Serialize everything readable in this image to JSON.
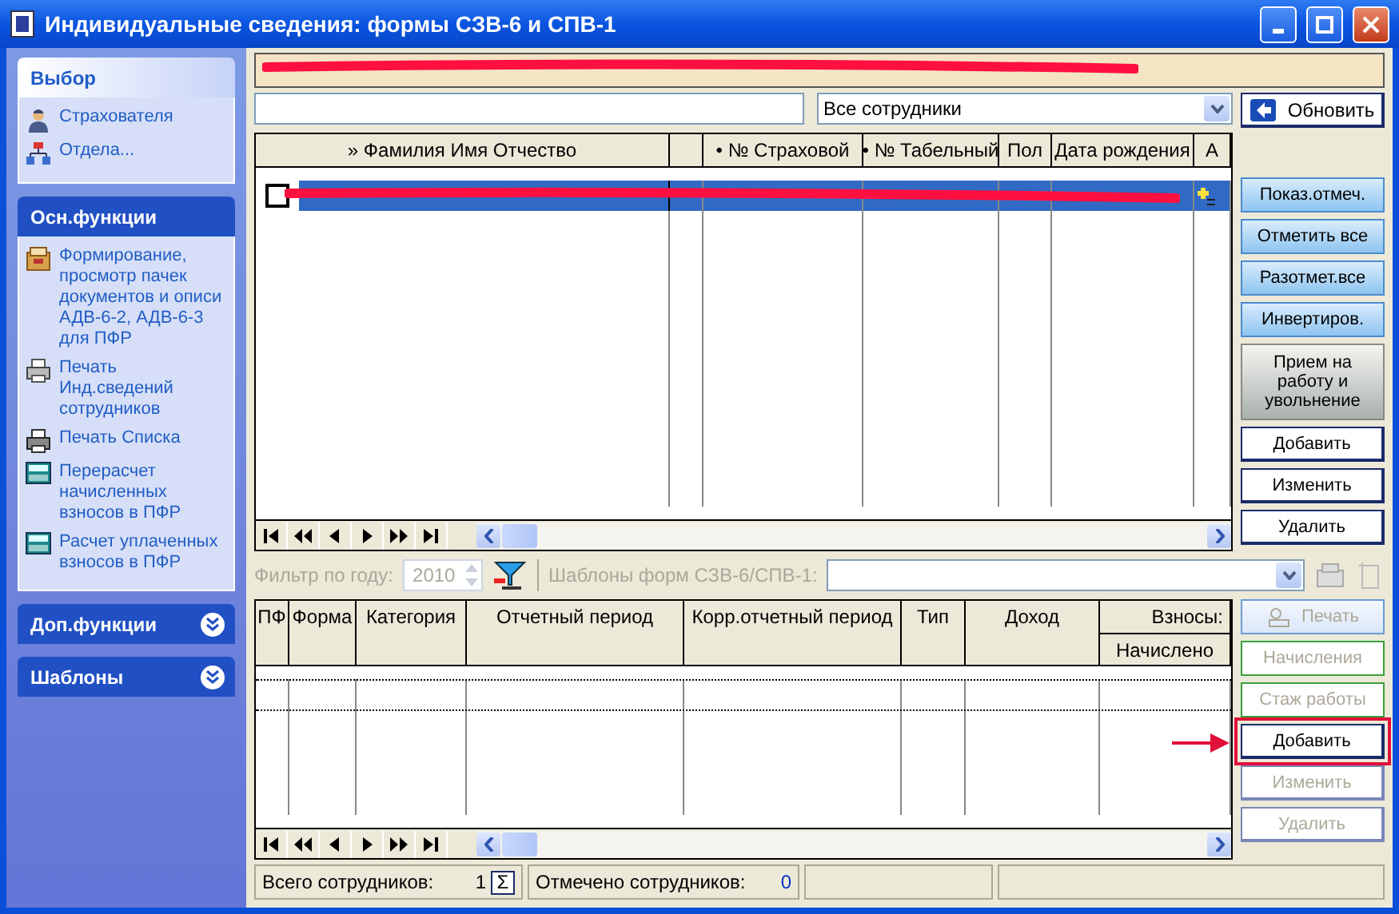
{
  "window": {
    "title": "Индивидуальные сведения: формы СЗВ-6 и СПВ-1"
  },
  "sidebar": {
    "groups": [
      {
        "title": "Выбор",
        "kind": "light",
        "expanded": true,
        "items": [
          {
            "label": "Страхователя"
          },
          {
            "label": "Отдела..."
          }
        ]
      },
      {
        "title": "Осн.функции",
        "kind": "dark",
        "expanded": true,
        "items": [
          {
            "label": "Формирование, просмотр пачек документов и описи АДВ-6-2, АДВ-6-3 для ПФР"
          },
          {
            "label": "Печать Инд.сведений сотрудников"
          },
          {
            "label": "Печать Списка"
          },
          {
            "label": "Перерасчет начисленных взносов в ПФР"
          },
          {
            "label": "Расчет уплаченных взносов в ПФР"
          }
        ]
      },
      {
        "title": "Доп.функции",
        "kind": "dark",
        "expanded": false
      },
      {
        "title": "Шаблоны",
        "kind": "dark",
        "expanded": false
      }
    ]
  },
  "banner": {
    "redacted": true
  },
  "employee_filter": {
    "value": "Все сотрудники"
  },
  "refresh_button": {
    "label": "Обновить"
  },
  "employees_table": {
    "columns": [
      {
        "label": "» Фамилия Имя Отчество"
      },
      {
        "label": "• № Страховой"
      },
      {
        "label": "• № Табельный"
      },
      {
        "label": "Пол"
      },
      {
        "label": "Дата рождения"
      },
      {
        "label": "А"
      }
    ],
    "rows": [
      {
        "selected": true,
        "checked": false,
        "redacted": true
      }
    ]
  },
  "employee_buttons": [
    {
      "label": "Показ.отмеч.",
      "kind": "toggle",
      "disabled": false,
      "highlighted": false
    },
    {
      "label": "Отметить все",
      "kind": "toggle",
      "disabled": false,
      "highlighted": false
    },
    {
      "label": "Разотмет.все",
      "kind": "toggle",
      "disabled": false,
      "highlighted": false
    },
    {
      "label": "Инвертиров.",
      "kind": "toggle",
      "disabled": false,
      "highlighted": false
    },
    {
      "label": "Прием на работу и увольнение",
      "kind": "tall",
      "disabled": false,
      "highlighted": false
    },
    {
      "label": "Добавить",
      "kind": "action",
      "disabled": false,
      "highlighted": false
    },
    {
      "label": "Изменить",
      "kind": "action",
      "disabled": false,
      "highlighted": false
    },
    {
      "label": "Удалить",
      "kind": "action",
      "disabled": false,
      "highlighted": false
    }
  ],
  "filter_bar": {
    "disabled": true,
    "year_label": "Фильтр по году:",
    "year": "2010",
    "templates_label": "Шаблоны форм СЗВ-6/СПВ-1:"
  },
  "forms_table": {
    "columns": [
      {
        "label": "ПФ"
      },
      {
        "label": "Форма"
      },
      {
        "label": "Категория"
      },
      {
        "label": "Отчетный период"
      },
      {
        "label": "Корр.отчетный период"
      },
      {
        "label": "Тип"
      },
      {
        "label": "Доход"
      },
      {
        "label": "Взносы:",
        "sub": "Начислено"
      }
    ]
  },
  "form_buttons": [
    {
      "label": "Печать",
      "kind": "print",
      "disabled": true,
      "highlighted": false
    },
    {
      "label": "Начисления",
      "kind": "green",
      "disabled": true,
      "highlighted": false
    },
    {
      "label": "Стаж работы",
      "kind": "green",
      "disabled": true,
      "highlighted": false
    },
    {
      "label": "Добавить",
      "kind": "action",
      "disabled": false,
      "highlighted": true
    },
    {
      "label": "Изменить",
      "kind": "action",
      "disabled": true,
      "highlighted": false
    },
    {
      "label": "Удалить",
      "kind": "action",
      "disabled": true,
      "highlighted": false
    }
  ],
  "status_bar": {
    "total_label": "Всего сотрудников:",
    "total": "1",
    "sum_button": "Σ",
    "marked_label": "Отмечено сотрудников:",
    "marked": "0"
  }
}
